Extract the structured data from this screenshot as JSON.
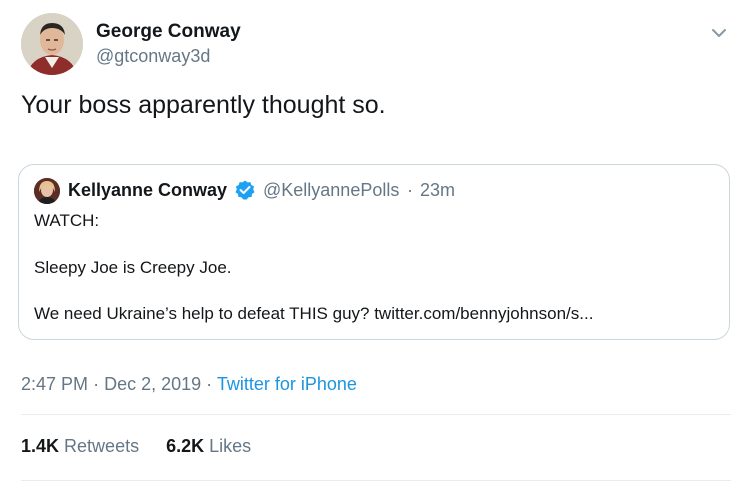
{
  "tweet": {
    "author": {
      "name": "George Conway",
      "handle": "@gtconway3d"
    },
    "text": "Your boss apparently thought so.",
    "quote": {
      "author": {
        "name": "Kellyanne Conway",
        "handle": "@KellyannePolls"
      },
      "separator": "·",
      "time": "23m",
      "lines": [
        "WATCH:",
        "Sleepy Joe is Creepy Joe.",
        "We need Ukraine’s help to defeat THIS guy? twitter.com/bennyjohnson/s..."
      ]
    },
    "meta": {
      "time": "2:47 PM",
      "date": "Dec 2, 2019",
      "separator": "·",
      "source": "Twitter for iPhone"
    },
    "stats": {
      "retweets_count": "1.4K",
      "retweets_label": "Retweets",
      "likes_count": "6.2K",
      "likes_label": "Likes"
    }
  },
  "colors": {
    "primary_text": "#14171a",
    "secondary_text": "#657786",
    "link": "#1b95e0",
    "verified": "#1da1f2",
    "border": "#ccd6dd"
  },
  "icons": {
    "menu": "chevron-down-icon",
    "verified": "verified-badge-icon"
  }
}
